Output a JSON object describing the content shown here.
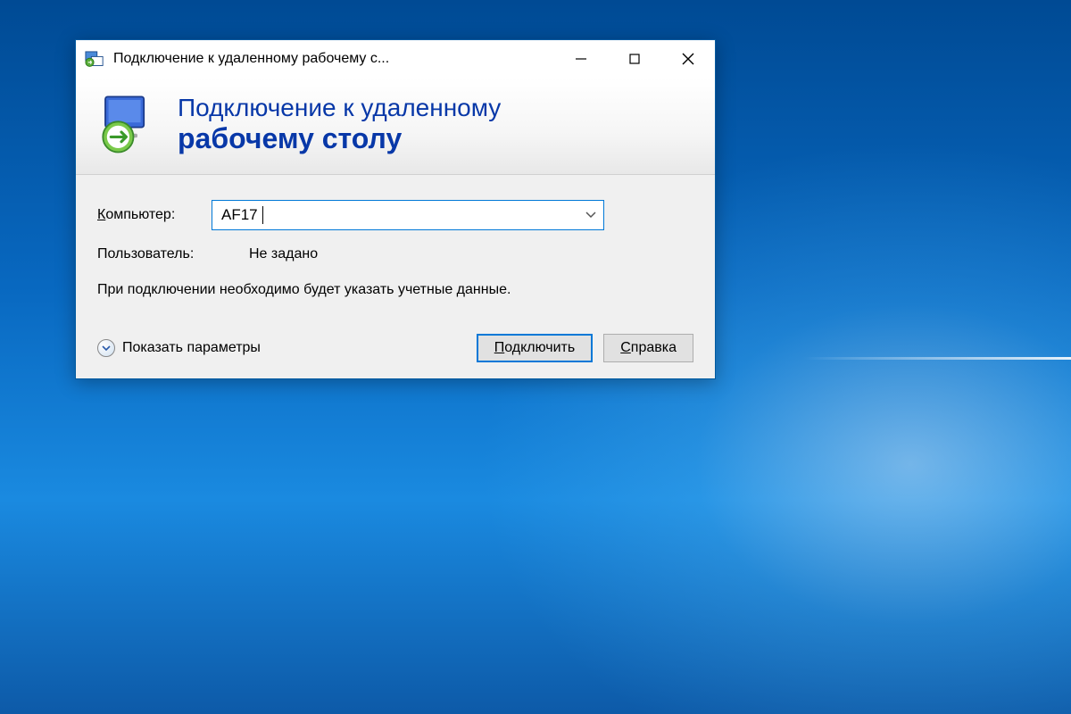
{
  "window": {
    "title": "Подключение к удаленному рабочему с..."
  },
  "banner": {
    "line1": "Подключение к удаленному",
    "line2": "рабочему столу"
  },
  "form": {
    "computer_label": "Компьютер:",
    "computer_value": "AF17",
    "user_label": "Пользователь:",
    "user_value": "Не задано",
    "info_text": "При подключении необходимо будет указать учетные данные."
  },
  "footer": {
    "expand_label": "Показать параметры",
    "connect_prefix": "П",
    "connect_rest": "одключить",
    "help_prefix": "С",
    "help_rest": "правка"
  }
}
